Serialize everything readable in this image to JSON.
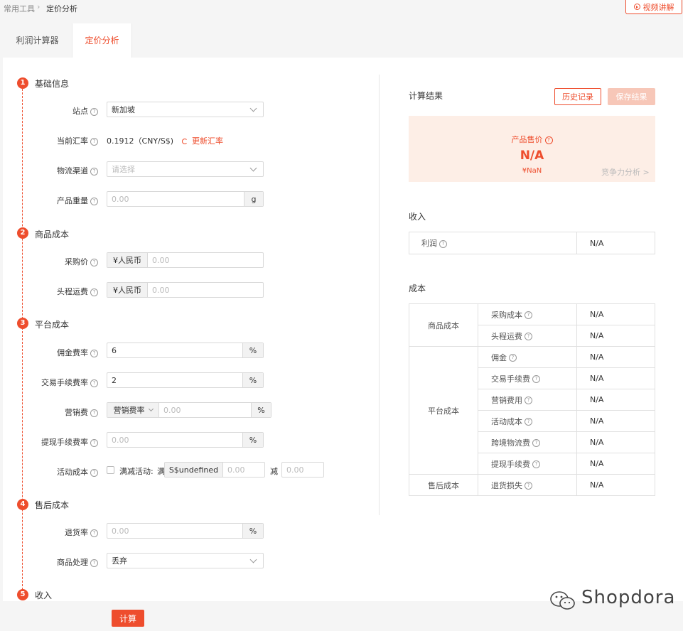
{
  "breadcrumb": {
    "parent": "常用工具",
    "separator": "›",
    "current": "定价分析"
  },
  "video_button": {
    "label": "视频讲解",
    "icon": "play-circle-icon"
  },
  "tabs": [
    {
      "label": "利润计算器",
      "active": false
    },
    {
      "label": "定价分析",
      "active": true
    }
  ],
  "accent_color": "#ee4d2d",
  "left": {
    "sections": [
      {
        "num": "1",
        "title": "基础信息"
      },
      {
        "num": "2",
        "title": "商品成本"
      },
      {
        "num": "3",
        "title": "平台成本"
      },
      {
        "num": "4",
        "title": "售后成本"
      },
      {
        "num": "5",
        "title": "收入"
      }
    ],
    "fields": {
      "site": {
        "label": "站点",
        "value": "新加坡"
      },
      "rate": {
        "label": "当前汇率",
        "value": "0.1912（CNY/S$)",
        "refresh": "更新汇率"
      },
      "logistics": {
        "label": "物流渠道",
        "placeholder": "请选择"
      },
      "weight": {
        "label": "产品重量",
        "placeholder": "0.00",
        "unit": "g"
      },
      "purchase": {
        "label": "采购价",
        "prefix": "¥人民币",
        "placeholder": "0.00"
      },
      "firstleg": {
        "label": "头程运费",
        "prefix": "¥人民币",
        "placeholder": "0.00"
      },
      "commission": {
        "label": "佣金费率",
        "value": "6",
        "unit": "%"
      },
      "transaction": {
        "label": "交易手续费率",
        "value": "2",
        "unit": "%"
      },
      "marketing": {
        "label": "营销费",
        "select": "营销费率",
        "placeholder": "0.00",
        "unit": "%"
      },
      "withdraw": {
        "label": "提现手续费率",
        "placeholder": "0.00",
        "unit": "%"
      },
      "activity": {
        "label": "活动成本",
        "check_label": "满减活动:",
        "full": "满",
        "currency": "S$undefined",
        "placeholder1": "0.00",
        "minus": "减",
        "placeholder2": "0.00"
      },
      "return_rate": {
        "label": "退货率",
        "placeholder": "0.00",
        "unit": "%"
      },
      "handling": {
        "label": "商品处理",
        "value": "丢弃"
      }
    },
    "calc_button": "计算"
  },
  "right": {
    "title": "计算结果",
    "history_button": "历史记录",
    "save_button": "保存结果",
    "price": {
      "label": "产品售价",
      "value": "N/A",
      "sub": "¥NaN",
      "link": "竞争力分析 >"
    },
    "income": {
      "title": "收入",
      "rows": [
        {
          "label": "利润",
          "value": "N/A"
        }
      ]
    },
    "cost": {
      "title": "成本",
      "groups": [
        {
          "name": "商品成本",
          "items": [
            {
              "label": "采购成本",
              "value": "N/A"
            },
            {
              "label": "头程运费",
              "value": "N/A"
            }
          ]
        },
        {
          "name": "平台成本",
          "items": [
            {
              "label": "佣金",
              "value": "N/A"
            },
            {
              "label": "交易手续费",
              "value": "N/A"
            },
            {
              "label": "营销费用",
              "value": "N/A"
            },
            {
              "label": "活动成本",
              "value": "N/A"
            },
            {
              "label": "跨境物流费",
              "value": "N/A"
            },
            {
              "label": "提现手续费",
              "value": "N/A"
            }
          ]
        },
        {
          "name": "售后成本",
          "items": [
            {
              "label": "退货损失",
              "value": "N/A"
            }
          ]
        }
      ]
    }
  },
  "watermark": {
    "text": "Shopdora",
    "icon": "wechat-icon"
  }
}
